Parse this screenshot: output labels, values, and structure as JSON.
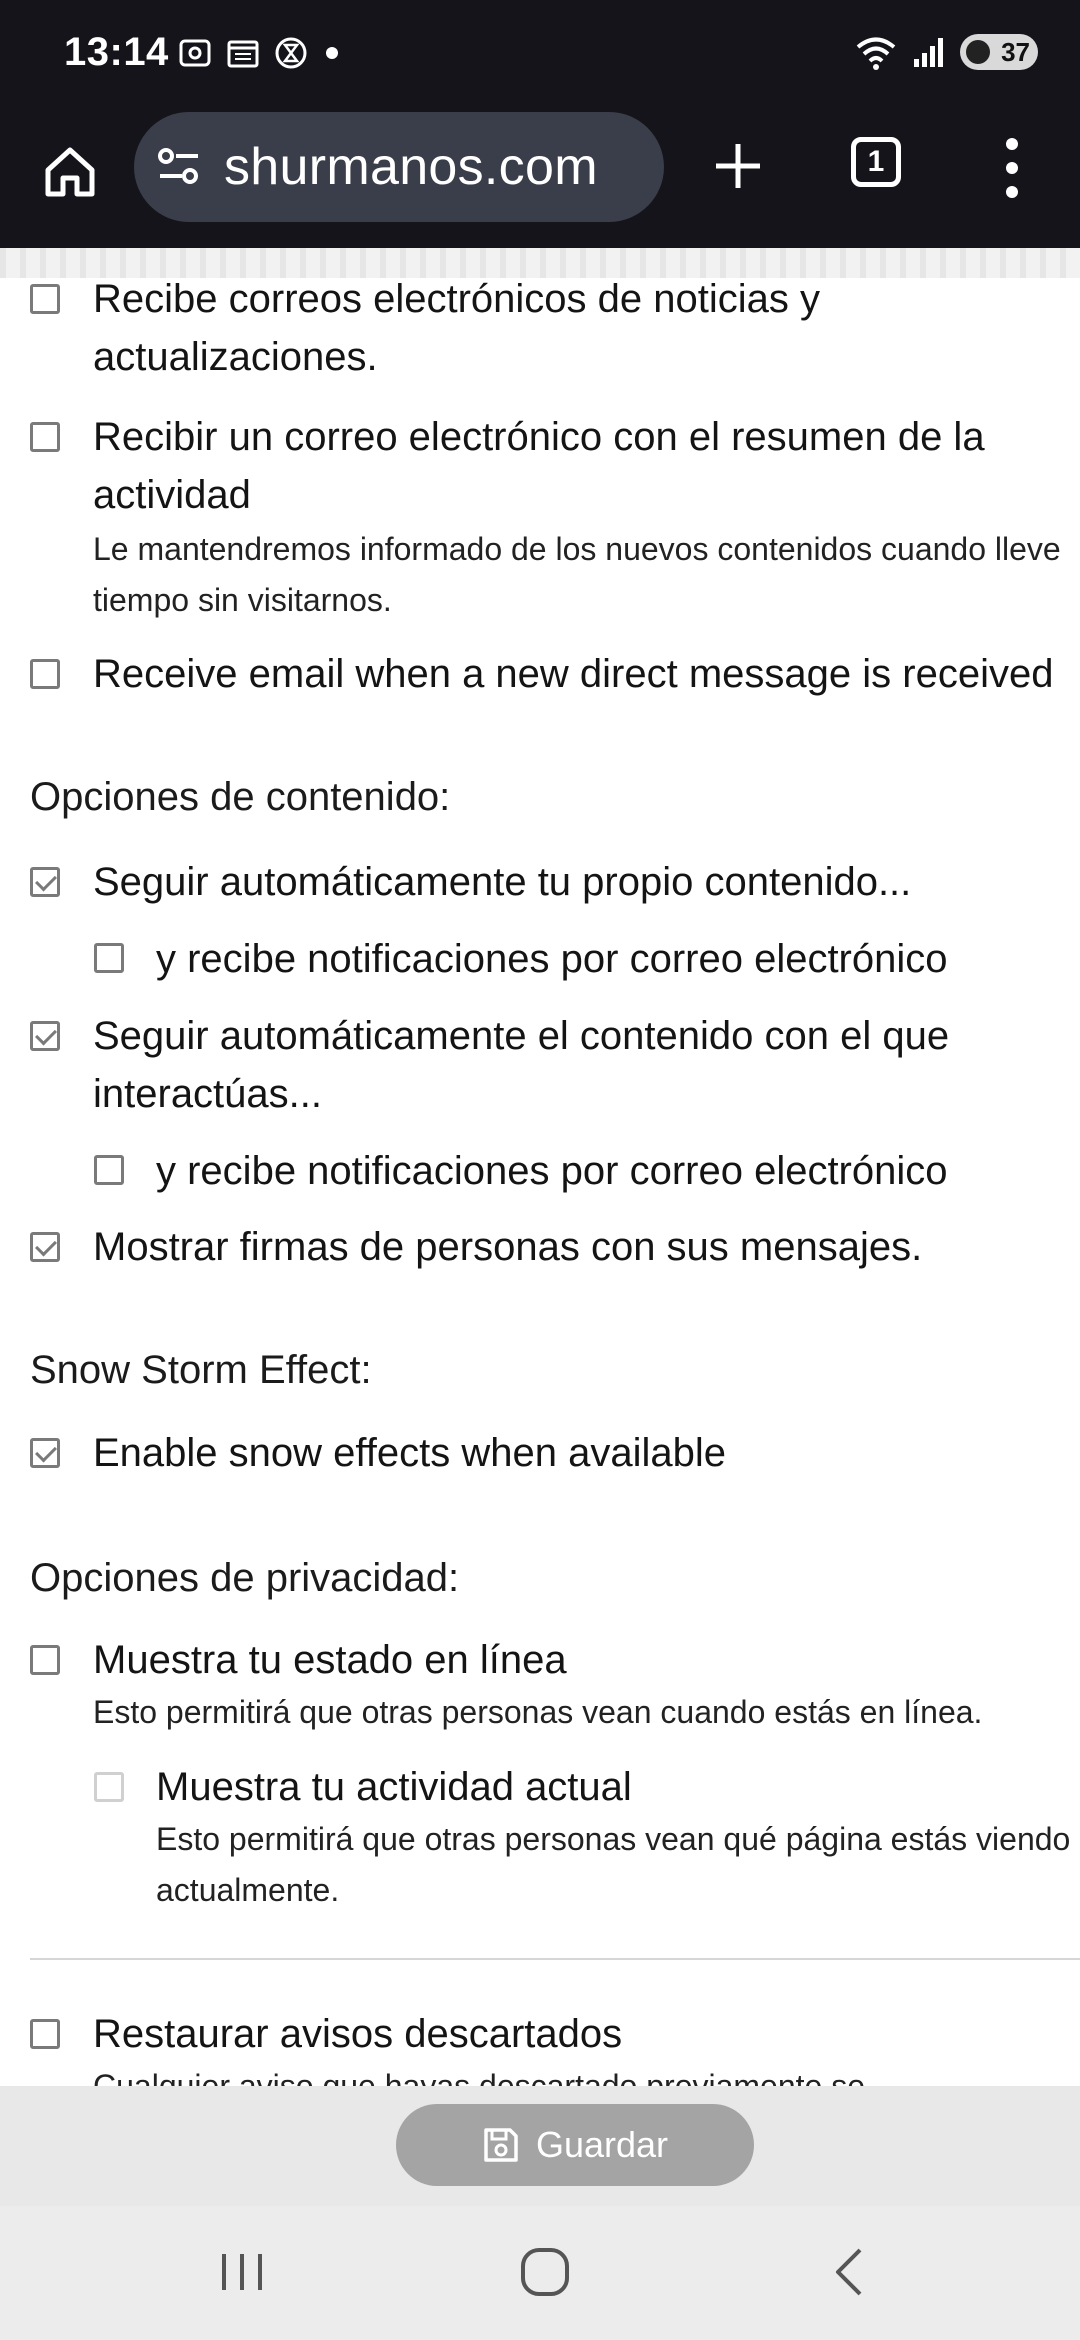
{
  "status_bar": {
    "time": "13:14",
    "battery": "37"
  },
  "browser": {
    "url": "shurmanos.com",
    "tab_count": "1"
  },
  "notifications": [
    {
      "label": "Recibe correos electrónicos de noticias y actualizaciones.",
      "checked": false
    },
    {
      "label": "Recibir un correo electrónico con el resumen de la actividad",
      "description": "Le mantendremos informado de los nuevos contenidos cuando lleve tiempo sin visitarnos.",
      "checked": false
    },
    {
      "label": "Receive email when a new direct message is received",
      "checked": false
    }
  ],
  "content_options": {
    "heading": "Opciones de contenido:",
    "items": [
      {
        "label": "Seguir automáticamente tu propio contenido...",
        "checked": true
      },
      {
        "label": "y recibe notificaciones por correo electrónico",
        "checked": false
      },
      {
        "label": "Seguir automáticamente el contenido con el que interactúas...",
        "checked": true
      },
      {
        "label": "y recibe notificaciones por correo electrónico",
        "checked": false
      },
      {
        "label": "Mostrar firmas de personas con sus mensajes.",
        "checked": true
      }
    ]
  },
  "snow": {
    "heading": "Snow Storm Effect:",
    "label": "Enable snow effects when available",
    "checked": true
  },
  "privacy": {
    "heading": "Opciones de privacidad:",
    "online_label": "Muestra tu estado en línea",
    "online_desc": "Esto permitirá que otras personas vean cuando estás en línea.",
    "activity_label": "Muestra tu actividad actual",
    "activity_desc": "Esto permitirá que otras personas vean qué página estás viendo actualmente."
  },
  "restore": {
    "label": "Restaurar avisos descartados",
    "desc": "Cualquier aviso que hayas descartado previamente se"
  },
  "footer": {
    "save_label": "Guardar"
  }
}
